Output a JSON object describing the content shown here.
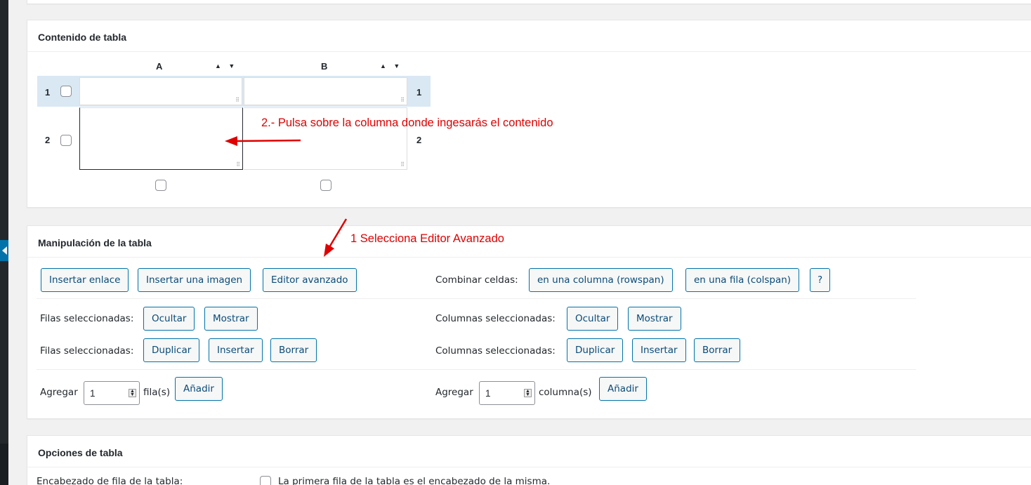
{
  "content_box": {
    "title": "Contenido de tabla",
    "columns": [
      "A",
      "B"
    ],
    "sort_icon": "▲ ▼",
    "rows": [
      "1",
      "2"
    ]
  },
  "annotations": {
    "step2": "2.- Pulsa sobre la columna donde ingesarás el contenido",
    "step1": "1 Selecciona Editor Avanzado",
    "color": "#e00000"
  },
  "manip_box": {
    "title": "Manipulación de la tabla",
    "insert_link": "Insertar enlace",
    "insert_image": "Insertar una imagen",
    "advanced_editor": "Editor avanzado",
    "merge_label": "Combinar celdas:",
    "rowspan": "en una columna (rowspan)",
    "colspan": "en una fila (colspan)",
    "help": "?",
    "rows_selected": "Filas seleccionadas:",
    "cols_selected": "Columnas seleccionadas:",
    "hide": "Ocultar",
    "show": "Mostrar",
    "duplicate": "Duplicar",
    "insert": "Insertar",
    "delete": "Borrar",
    "add": "Agregar",
    "rows_value": "1",
    "rows_unit": "fila(s)",
    "cols_value": "1",
    "cols_unit": "columna(s)",
    "add_button": "Añadir"
  },
  "options_box": {
    "title": "Opciones de tabla",
    "first_row_label": "Encabezado de fila de la tabla:",
    "first_row_desc": "La primera fila de la tabla es el encabezado de la misma."
  },
  "colors": {
    "accent": "#0073aa",
    "sidebar": "#23282d",
    "row_highlight": "#d9e8f3"
  }
}
